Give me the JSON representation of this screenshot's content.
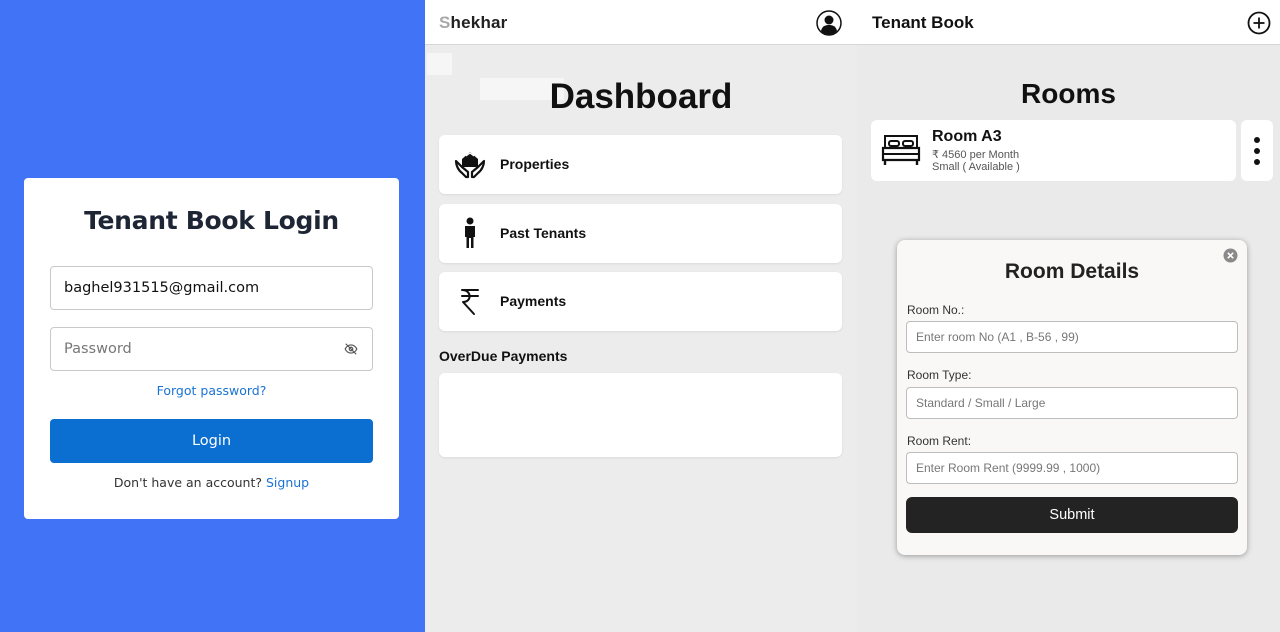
{
  "login": {
    "title": "Tenant Book Login",
    "email_value": "baghel931515@gmail.com",
    "password_placeholder": "Password",
    "forgot_password": "Forgot password?",
    "login_label": "Login",
    "no_account_text": "Don't have an account?",
    "signup_label": "Signup",
    "colors": {
      "background": "#4073f5",
      "button": "#0a6fd1",
      "link": "#1a73d4"
    }
  },
  "dashboard": {
    "user_first_letter": "S",
    "user_rest": "hekhar",
    "avatar_icon": "user-avatar-icon",
    "title": "Dashboard",
    "menu": [
      {
        "label": "Properties",
        "icon": "house-in-hands-icon"
      },
      {
        "label": "Past Tenants",
        "icon": "person-icon"
      },
      {
        "label": "Payments",
        "icon": "rupee-icon"
      }
    ],
    "overdue_label": "OverDue Payments"
  },
  "rooms": {
    "app_title": "Tenant Book",
    "add_icon": "add-circle-icon",
    "title": "Rooms",
    "room": {
      "name": "Room A3",
      "rent": "₹ 4560 per Month",
      "size": "Small ( Available )",
      "icon": "bed-icon"
    },
    "modal": {
      "title": "Room Details",
      "room_no_label": "Room No.:",
      "room_no_placeholder": "Enter room No (A1 , B-56 , 99)",
      "room_type_label": "Room Type:",
      "room_type_placeholder": "Standard / Small / Large",
      "room_rent_label": "Room Rent:",
      "room_rent_placeholder": "Enter Room Rent (9999.99 , 1000)",
      "submit_label": "Submit"
    }
  }
}
